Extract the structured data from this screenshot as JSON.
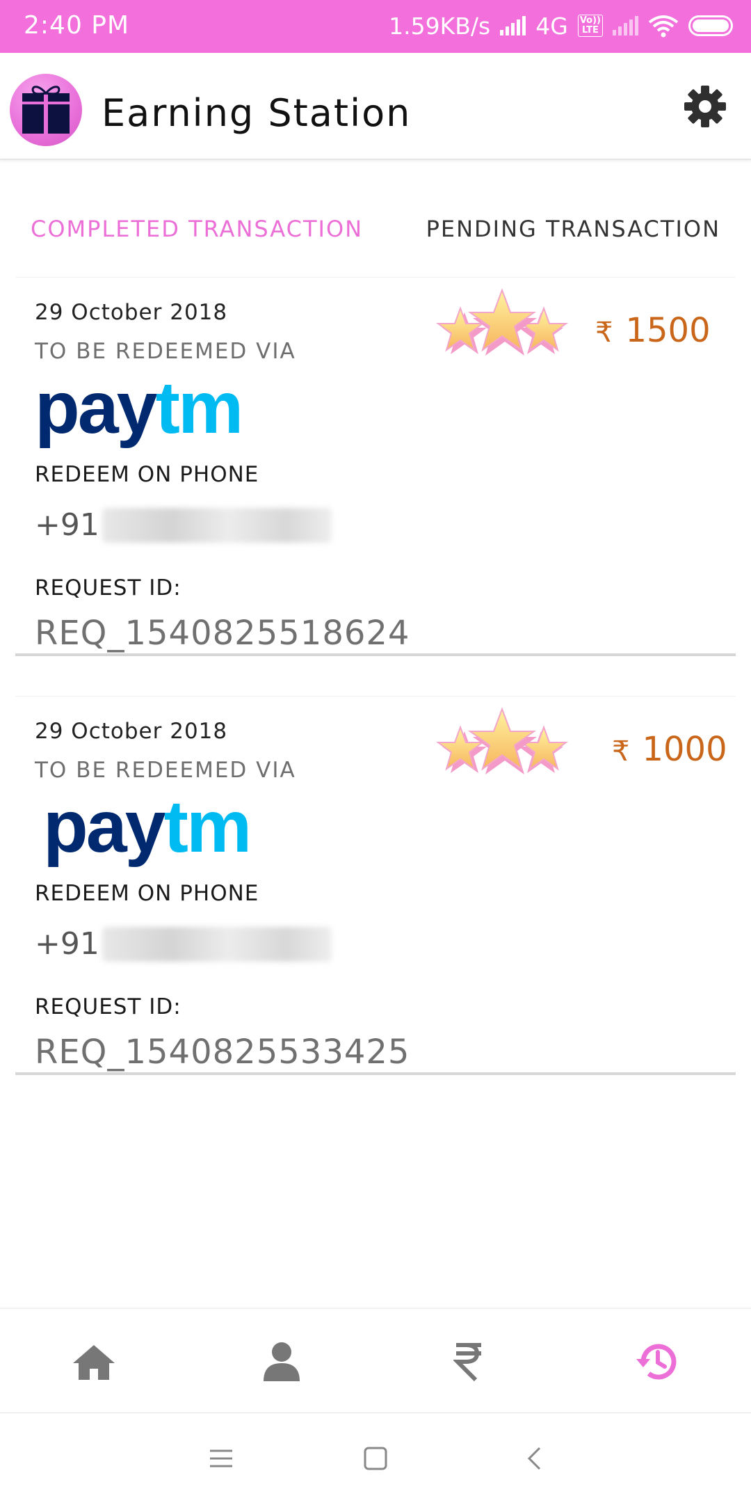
{
  "status_bar": {
    "time": "2:40 PM",
    "speed": "1.59KB/s",
    "network": "4G",
    "volte_top": "Vo))",
    "volte_bottom": "LTE"
  },
  "app_bar": {
    "title": "Earning Station",
    "logo_icon": "gift-box-icon",
    "settings_icon": "gear-icon"
  },
  "tabs": [
    {
      "label": "COMPLETED TRANSACTION",
      "active": true
    },
    {
      "label": "PENDING TRANSACTION",
      "active": false
    }
  ],
  "transactions": [
    {
      "date": "29 October 2018",
      "via_label": "TO BE REDEEMED VIA",
      "provider_pay": "pay",
      "provider_tm": "tm",
      "phone_label": "REDEEM ON PHONE",
      "phone_prefix": "+91",
      "request_label": "REQUEST ID:",
      "request_id": "REQ_1540825518624",
      "currency": "₹",
      "amount": "1500"
    },
    {
      "date": "29 October 2018",
      "via_label": "TO BE REDEEMED VIA",
      "provider_pay": "pay",
      "provider_tm": "tm",
      "phone_label": "REDEEM ON PHONE",
      "phone_prefix": "+91",
      "request_label": "REQUEST ID:",
      "request_id": "REQ_1540825533425",
      "currency": "₹",
      "amount": "1000"
    }
  ],
  "bottom_nav": [
    {
      "icon": "home-icon",
      "active": false
    },
    {
      "icon": "profile-icon",
      "active": false
    },
    {
      "icon": "rupee-icon",
      "active": false
    },
    {
      "icon": "history-icon",
      "active": true
    }
  ],
  "colors": {
    "accent": "#f26fdc",
    "amount": "#c9661a",
    "paytm_dark": "#002970",
    "paytm_light": "#00baf2",
    "nav_inactive": "#777777"
  }
}
